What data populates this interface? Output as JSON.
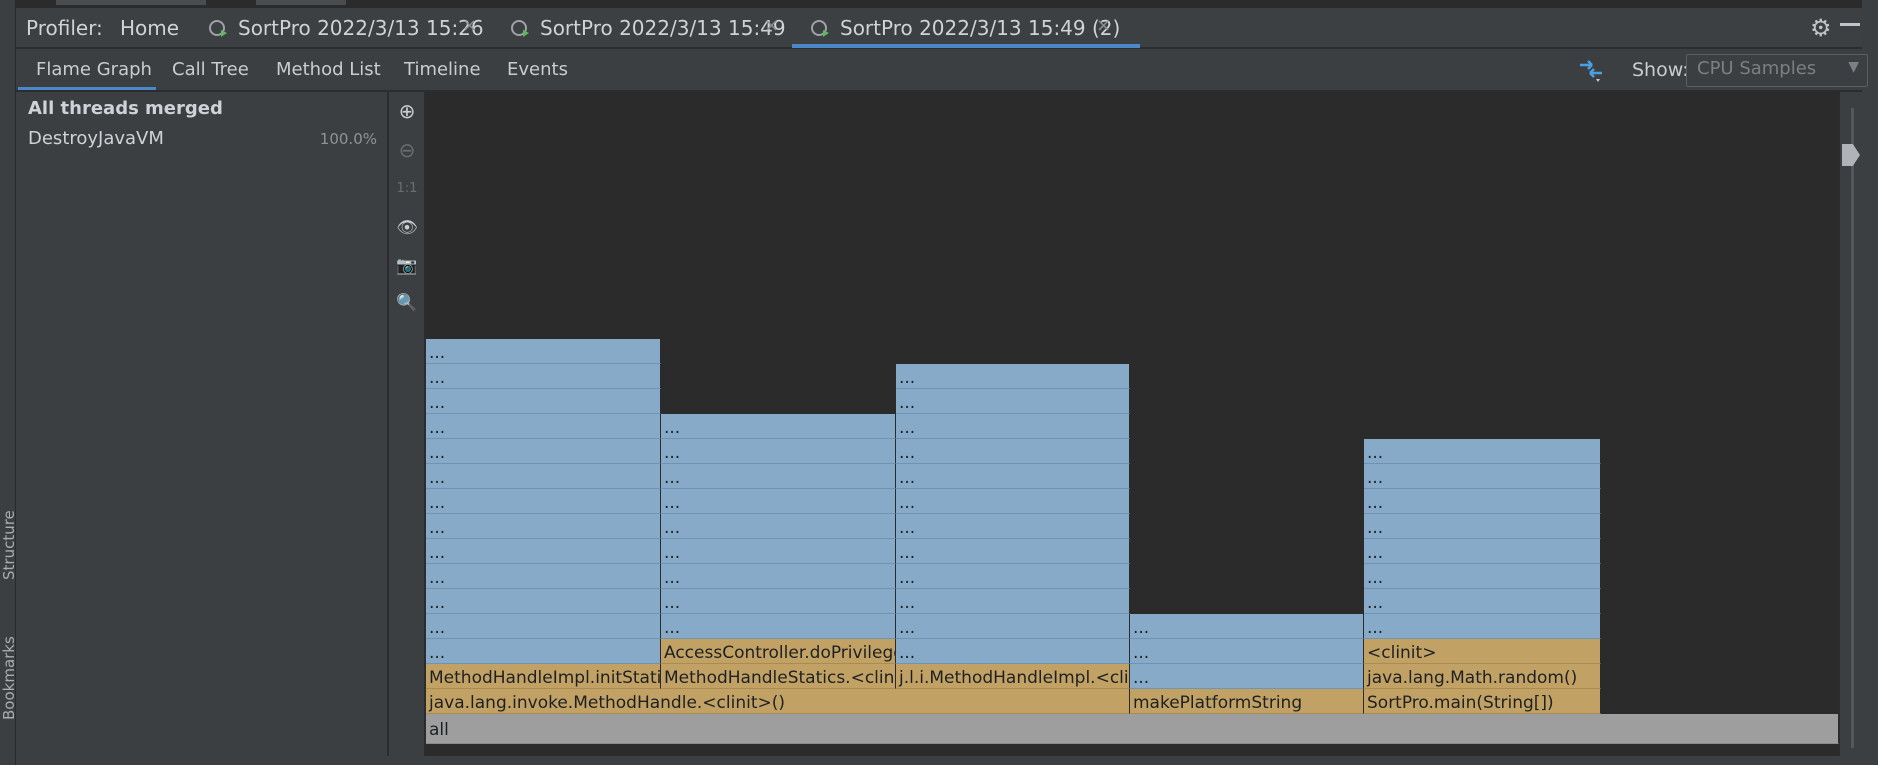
{
  "header": {
    "title": "Profiler:",
    "home": "Home",
    "tabs": [
      {
        "label": "SortPro 2022/3/13 15:26",
        "active": false
      },
      {
        "label": "SortPro 2022/3/13 15:49",
        "active": false
      },
      {
        "label": "SortPro 2022/3/13 15:49 (2)",
        "active": true
      }
    ],
    "close_glyph": "×",
    "gear_glyph": "⚙"
  },
  "subtabs": [
    "Flame Graph",
    "Call Tree",
    "Method List",
    "Timeline",
    "Events"
  ],
  "show": {
    "label": "Show:",
    "value": "CPU Samples"
  },
  "threads": {
    "title": "All threads merged",
    "items": [
      {
        "name": "DestroyJavaVM",
        "percent": "100.0%"
      }
    ]
  },
  "toolbar": {
    "zoom_in": "⊕",
    "zoom_out": "⊖",
    "reset": "1:1",
    "eye": "👁",
    "camera": "📷",
    "search": "🔍"
  },
  "side_labels": {
    "structure": "Structure",
    "bookmarks": "Bookmarks"
  },
  "flame": {
    "columns": [
      {
        "frames": [
          "java.lang.invoke.MethodHandle.<clinit>()",
          "MethodHandleImpl.initStatics",
          "...",
          "...",
          "...",
          "...",
          "...",
          "...",
          "...",
          "...",
          "...",
          "...",
          "...",
          "...",
          "..."
        ]
      },
      {
        "frames": [
          "",
          "MethodHandleStatics.<clinit>",
          "AccessController.doPrivileged",
          "...",
          "...",
          "...",
          "...",
          "...",
          "...",
          "...",
          "...",
          "..."
        ]
      },
      {
        "frames": [
          "",
          "j.l.i.MethodHandleImpl.<clinit>",
          "...",
          "...",
          "...",
          "...",
          "...",
          "...",
          "...",
          "...",
          "...",
          "...",
          "...",
          "..."
        ]
      },
      {
        "frames": [
          "makePlatformString",
          "...",
          "...",
          "..."
        ]
      },
      {
        "frames": [
          "SortPro.main(String[])",
          "java.lang.Math.random()",
          "<clinit>",
          "...",
          "...",
          "...",
          "...",
          "...",
          "...",
          "...",
          "..."
        ]
      }
    ],
    "root": "all"
  },
  "colors": {
    "blue": "#86aac7",
    "gold": "#c2a264",
    "gray": "#9e9e9e",
    "accent": "#4a88c7"
  }
}
